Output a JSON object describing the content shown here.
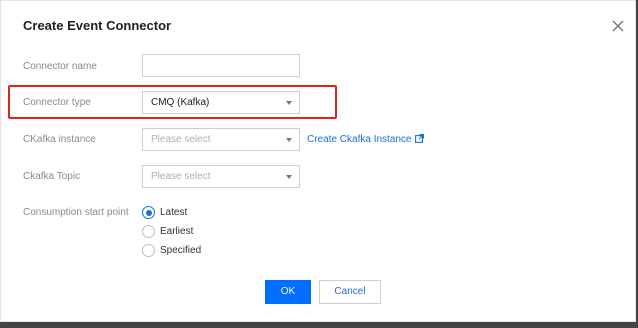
{
  "dialog": {
    "title": "Create Event Connector",
    "close_icon": "close-icon"
  },
  "form": {
    "connector_name": {
      "label": "Connector name",
      "value": ""
    },
    "connector_type": {
      "label": "Connector type",
      "value": "CMQ (Kafka)",
      "highlight_color": "#e2231a"
    },
    "ckafka_instance": {
      "label": "CKafka instance",
      "placeholder": "Please select",
      "link_text": "Create Ckafka Instance",
      "link_icon": "external-link-icon"
    },
    "ckafka_topic": {
      "label": "Ckafka Topic",
      "placeholder": "Please select"
    },
    "consumption_start_point": {
      "label": "Consumption start point",
      "options": [
        "Latest",
        "Earliest",
        "Specified"
      ],
      "selected": "Latest"
    }
  },
  "buttons": {
    "ok": "OK",
    "cancel": "Cancel"
  },
  "colors": {
    "primary": "#006eff",
    "link": "#1a6fd6",
    "highlight": "#e2231a"
  }
}
